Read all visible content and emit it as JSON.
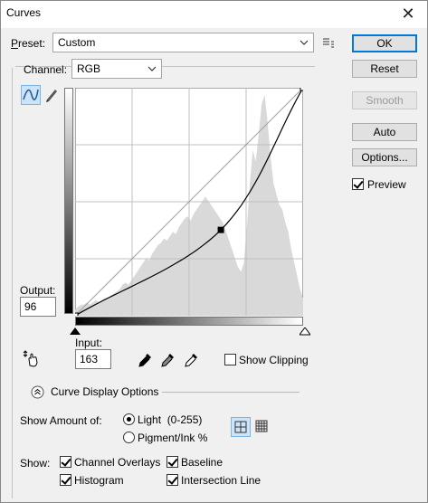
{
  "window": {
    "title": "Curves",
    "close_glyph": "✕"
  },
  "preset": {
    "label": "Preset:",
    "value": "Custom"
  },
  "channel": {
    "label": "Channel:",
    "value": "RGB"
  },
  "buttons": {
    "ok": "OK",
    "reset": "Reset",
    "smooth": "Smooth",
    "auto": "Auto",
    "options": "Options..."
  },
  "preview": {
    "label": "Preview",
    "checked": true
  },
  "output": {
    "label": "Output:",
    "value": "96"
  },
  "input": {
    "label": "Input:",
    "value": "163"
  },
  "show_clipping": {
    "label": "Show Clipping",
    "checked": false
  },
  "curve_display": {
    "label": "Curve Display Options",
    "expanded": true
  },
  "show_amount": {
    "label": "Show Amount of:",
    "light_label": "Light  (0-255)",
    "pigment_label": "Pigment/Ink %",
    "selected": "light"
  },
  "show": {
    "label": "Show:",
    "channel_overlays": {
      "label": "Channel Overlays",
      "checked": true
    },
    "baseline": {
      "label": "Baseline",
      "checked": true
    },
    "histogram": {
      "label": "Histogram",
      "checked": true
    },
    "intersection_line": {
      "label": "Intersection Line",
      "checked": true
    }
  },
  "grid_view": {
    "selected": "simple"
  },
  "chart_data": {
    "type": "line",
    "xlim": [
      0,
      255
    ],
    "ylim": [
      0,
      255
    ],
    "gridlines": 4,
    "baseline": [
      [
        0,
        0
      ],
      [
        255,
        255
      ]
    ],
    "curve_points": [
      [
        0,
        0
      ],
      [
        163,
        96
      ],
      [
        255,
        255
      ]
    ],
    "selected_point": [
      163,
      96
    ],
    "histogram_levels": [
      3,
      4,
      5,
      5,
      6,
      5,
      6,
      7,
      6,
      7,
      8,
      8,
      9,
      10,
      11,
      12,
      14,
      15,
      14,
      16,
      18,
      20,
      22,
      24,
      26,
      25,
      28,
      30,
      32,
      33,
      35,
      34,
      36,
      38,
      37,
      40,
      42,
      44,
      45,
      43,
      46,
      48,
      50,
      52,
      54,
      52,
      50,
      48,
      46,
      44,
      42,
      38,
      34,
      30,
      26,
      22,
      20,
      24,
      40,
      60,
      75,
      70,
      82,
      96,
      100,
      88,
      72,
      60,
      55,
      50,
      48,
      42,
      38,
      30,
      24,
      18,
      12,
      8
    ]
  },
  "colors": {
    "accent": "#0078d7",
    "histogram": "#d9d9d9",
    "grid": "#c0c0c0",
    "selection": "#cce4f7"
  }
}
